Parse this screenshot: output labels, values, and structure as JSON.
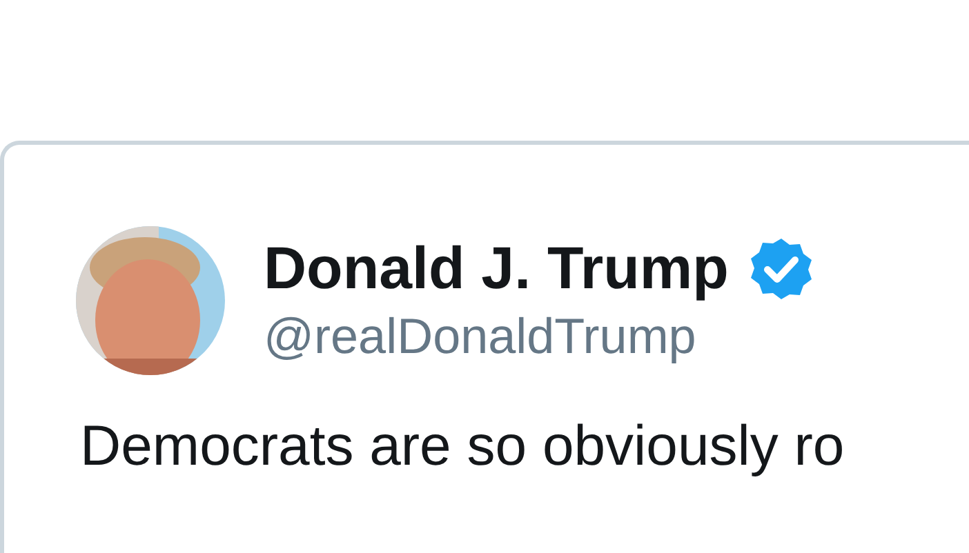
{
  "tweet": {
    "author": {
      "name": "Donald J. Trump",
      "handle": "@realDonaldTrump",
      "verified": true
    },
    "text": "Democrats are so obviously ro"
  }
}
